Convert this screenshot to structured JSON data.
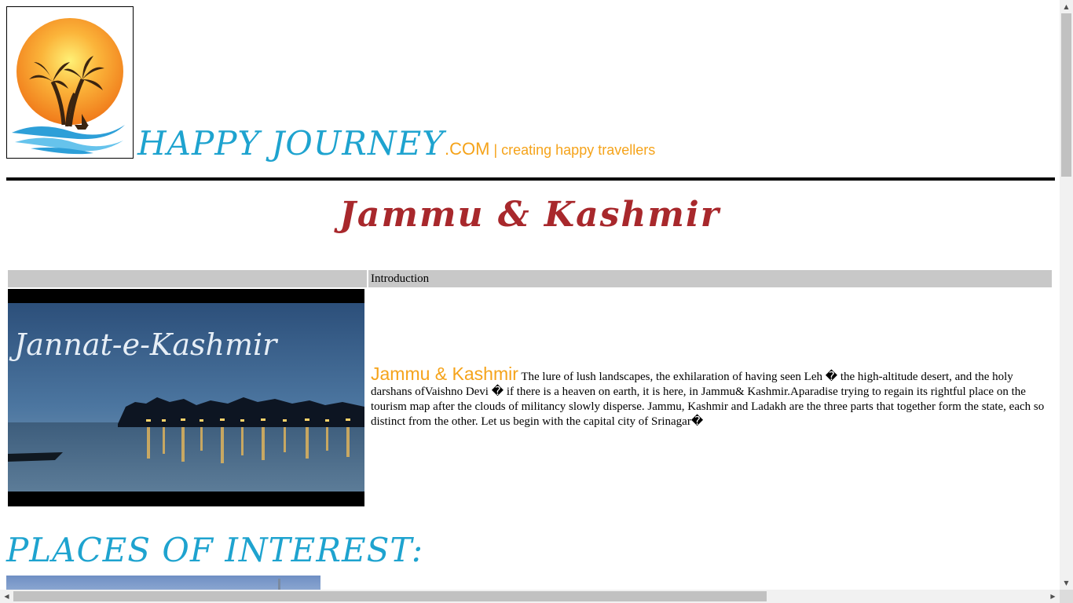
{
  "header": {
    "brand_name": "HAPPY JOURNEY",
    "brand_domain": ".COM",
    "brand_separator": " | ",
    "tagline": "creating happy travellers",
    "logo_icon": "sunset-palm-trees-logo"
  },
  "page": {
    "title": "Jammu & Kashmir"
  },
  "intro": {
    "header_label": "Introduction",
    "image_caption": "Jannat-e-Kashmir",
    "lead": "Jammu & Kashmir",
    "body": " The lure of lush landscapes, the exhilaration of having seen Leh � the high-altitude desert, and the holy darshans ofVaishno Devi � if there is a heaven on earth, it is here, in Jammu& Kashmir.Aparadise trying to regain its rightful place on the tourism map after the clouds of militancy slowly disperse. Jammu, Kashmir and Ladakh are the three parts that together form the state, each so distinct from the other. Let us begin with the capital city of Srinagar�"
  },
  "places": {
    "title": "PLACES OF INTEREST:"
  },
  "colors": {
    "brand_blue": "#1ea3cf",
    "brand_orange": "#f5a31a",
    "title_red": "#a8282c",
    "table_header_gray": "#c8c8c8"
  }
}
